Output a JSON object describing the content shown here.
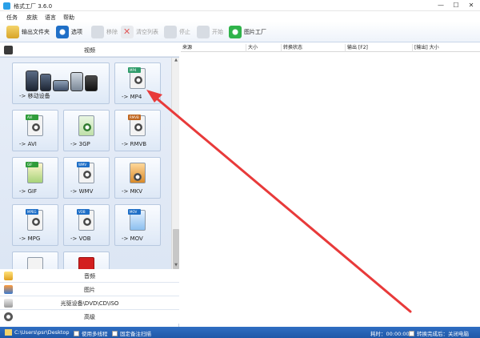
{
  "window": {
    "title": "格式工厂 3.6.0",
    "controls": [
      "—",
      "☐",
      "✕"
    ]
  },
  "menu": [
    "任务",
    "皮肤",
    "语言",
    "帮助"
  ],
  "toolbar": {
    "output_folder": "输出文件夹",
    "options": "选项",
    "remove": "移除",
    "clear_list": "清空列表",
    "stop": "停止",
    "start": "开始",
    "picture_factory": "图片工厂"
  },
  "sidebar": {
    "video_header": "视频",
    "tiles": [
      {
        "label": "-> 移动设备",
        "badge": "",
        "color": ""
      },
      {
        "label": "-> MP4",
        "badge": "MP4",
        "color": "#2f9c6a"
      },
      {
        "label": "-> AVI",
        "badge": "AVI",
        "color": "#2f9c3a"
      },
      {
        "label": "-> 3GP",
        "badge": "",
        "color": ""
      },
      {
        "label": "-> RMVB",
        "badge": "RMVB",
        "color": "#c0661f"
      },
      {
        "label": "-> GIF",
        "badge": "GIF",
        "color": "#2f9c3a"
      },
      {
        "label": "-> WMV",
        "badge": "WMV",
        "color": "#1f6fc7"
      },
      {
        "label": "-> MKV",
        "badge": "",
        "color": ""
      },
      {
        "label": "-> MPG",
        "badge": "MPEG",
        "color": "#1f6fc7"
      },
      {
        "label": "-> VOB",
        "badge": "VOB",
        "color": "#1f6fc7"
      },
      {
        "label": "-> MOV",
        "badge": "MOV",
        "color": "#1f6fc7"
      }
    ],
    "categories": [
      "音频",
      "图片",
      "光驱设备\\DVD\\CD\\ISO",
      "高级"
    ]
  },
  "table": {
    "columns": [
      "来源",
      "大小",
      "转换状态",
      "输出 [F2]",
      "[输出] 大小"
    ]
  },
  "statusbar": {
    "path": "C:\\Users\\psr\\Desktop",
    "multithread": "使用多线程",
    "shutdown": "转换完成后 关闭电脑",
    "elapsed": "耗时：00:00:00",
    "after_done": "转换完成后：关闭电脑",
    "check_option": "固定备注扫描"
  },
  "colors": {
    "accent": "#2f6ec2",
    "arrow": "#e83a3a"
  }
}
